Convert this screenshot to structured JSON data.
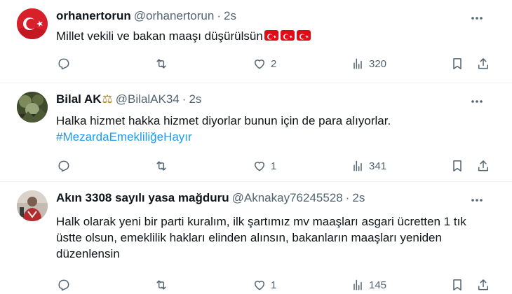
{
  "tweets": [
    {
      "name": "orhanertorun",
      "handle": "@orhanertorun",
      "sep": "·",
      "time": "2s",
      "text": "Millet vekili ve bakan maaşı düşürülsün",
      "flag_count": 3,
      "likes": "2",
      "views": "320"
    },
    {
      "name": "Bilal AK",
      "name_badge": "⚖",
      "handle": "@BilalAK34",
      "sep": "·",
      "time": "2s",
      "text": "Halka hizmet hakka hizmet diyorlar bunun için de para alıyorlar.",
      "hashtag": "#MezardaEmekliliğeHayır",
      "likes": "1",
      "views": "341"
    },
    {
      "name": "Akın 3308 sayılı yasa mağduru",
      "handle": "@Aknakay76245528",
      "sep": "·",
      "time": "2s",
      "text": "Halk olarak yeni bir parti kuralım, ilk şartımız mv maaşları asgari ücretten 1 tık üstte olsun, emeklilik hakları elinden alınsın, bakanların maaşları yeniden düzenlensin",
      "likes": "1",
      "views": "145"
    }
  ],
  "icons": [
    "more-icon",
    "reply-icon",
    "retweet-icon",
    "like-icon",
    "views-icon",
    "bookmark-icon",
    "share-icon"
  ],
  "colors": {
    "text": "#0f1419",
    "muted": "#536471",
    "link": "#1d9bf0",
    "divider": "#eff3f4",
    "flag_red": "#e30a17"
  }
}
